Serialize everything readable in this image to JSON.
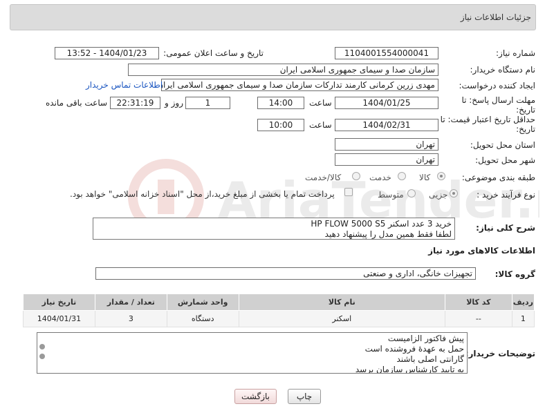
{
  "panel": {
    "title": "جزئیات اطلاعات نیاز"
  },
  "fields": {
    "need_number_label": "شماره نیاز:",
    "need_number": "1104001554000041",
    "announce_label": "تاریخ و ساعت اعلان عمومی:",
    "announce_value": "1404/01/23 - 13:52",
    "buyer_org_label": "نام دستگاه خریدار:",
    "buyer_org": "سازمان صدا و سیمای جمهوری اسلامی ایران",
    "requester_label": "ایجاد کننده درخواست:",
    "requester": "مهدی زرین کرمانی کارمند تدارکات سازمان صدا و سیمای جمهوری اسلامی ایران",
    "contact_link": "اطلاعات تماس خریدار",
    "deadline_label": "مهلت ارسال پاسخ: تا تاریخ:",
    "deadline_date": "1404/01/25",
    "time_word": "ساعت",
    "deadline_time": "14:00",
    "days_value": "1",
    "days_word": "روز و",
    "remaining_time": "22:31:19",
    "remaining_word": "ساعت باقی مانده",
    "price_valid_label": "حداقل تاریخ اعتبار قیمت: تا تاریخ:",
    "price_valid_date": "1404/02/31",
    "price_valid_time": "10:00",
    "province_label": "استان محل تحویل:",
    "province": "تهران",
    "city_label": "شهر محل تحویل:",
    "city": "تهران",
    "category_label": "طبقه بندی موضوعی:",
    "category_options": [
      "کالا",
      "خدمت",
      "کالا/خدمت"
    ],
    "process_label": "نوع فرآیند خرید :",
    "process_options": [
      "جزیی",
      "متوسط"
    ],
    "payment_note": "پرداخت تمام یا بخشی از مبلغ خرید،از محل \"اسناد خزانه اسلامی\" خواهد بود."
  },
  "description": {
    "label": "شرح کلی نیاز:",
    "lines": [
      "خرید 3 عدد اسکنر HP FLOW 5000 S5",
      "لطفا فقط همین مدل را پیشنهاد دهید"
    ]
  },
  "goods_section": {
    "title": "اطلاعات کالاهای مورد نیاز",
    "group_label": "گروه کالا:",
    "group_value": "تجهیزات خانگی، اداری و صنعتی"
  },
  "table": {
    "headers": [
      "ردیف",
      "کد کالا",
      "نام کالا",
      "واحد شمارش",
      "تعداد / مقدار",
      "تاریخ نیاز"
    ],
    "rows": [
      [
        "1",
        "--",
        "اسکنر",
        "دستگاه",
        "3",
        "1404/01/31"
      ]
    ]
  },
  "buyer_notes": {
    "label": "توضیحات خریدار:",
    "lines": [
      "پیش فاکتور الزامیست",
      "حمل به عهدهٔ فروشنده است",
      "گارانتی اصلی باشند",
      "به تایید کارشناس سازمان برسد"
    ]
  },
  "buttons": {
    "print": "چاپ",
    "back": "بازگشت"
  },
  "watermark": {
    "text": "AriaTender.neT"
  },
  "colors": {
    "link": "#1a55c0",
    "header_bg": "#d0d0d0",
    "panel_bg": "#dcdcdc"
  }
}
